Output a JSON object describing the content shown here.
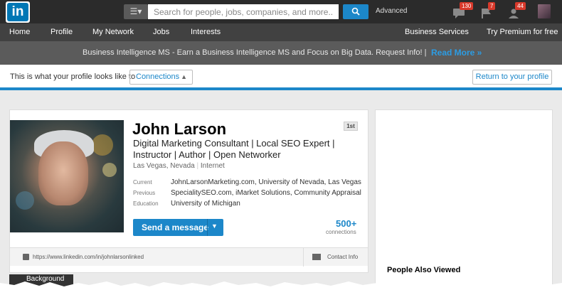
{
  "topbar": {
    "logo_text": "in",
    "search_placeholder": "Search for people, jobs, companies, and more...",
    "advanced_label": "Advanced",
    "notifications": [
      {
        "icon": "messages-icon",
        "count": "130"
      },
      {
        "icon": "flag-icon",
        "count": "7"
      },
      {
        "icon": "add-connection-icon",
        "count": "44"
      }
    ]
  },
  "nav": {
    "items": [
      "Home",
      "Profile",
      "My Network",
      "Jobs",
      "Interests"
    ],
    "business_services": "Business Services",
    "premium": "Try Premium for free"
  },
  "banner": {
    "text": "Business Intelligence MS - Earn a Business Intelligence MS and Focus on Big Data. Request Info! |",
    "link": "Read More »"
  },
  "view_strip": {
    "label": "This is what your profile looks like to",
    "selected": "Connections",
    "return_button": "Return to your profile"
  },
  "profile": {
    "name": "John Larson",
    "degree": "1st",
    "headline": "Digital Marketing Consultant | Local SEO Expert | Instructor | Author | Open Networker",
    "location": "Las Vegas, Nevada",
    "industry": "Internet",
    "rows": [
      {
        "label": "Current",
        "value": "JohnLarsonMarketing.com, University of Nevada, Las Vegas"
      },
      {
        "label": "Previous",
        "value": "SpecialitySEO.com, iMarket Solutions, Community Appraisal"
      },
      {
        "label": "Education",
        "value": "University of Michigan"
      }
    ],
    "send_message": "Send a message",
    "connections_count": "500+",
    "connections_label": "connections",
    "public_url": "https://www.linkedin.com/in/johnlarsonlinked",
    "contact_info": "Contact Info"
  },
  "background_tab": "Background",
  "right": {
    "people_also_viewed": "People Also Viewed"
  },
  "colors": {
    "accent": "#1c87c9",
    "topbar": "#2b2b2b",
    "nav": "#414141",
    "badge": "#d8392b"
  }
}
